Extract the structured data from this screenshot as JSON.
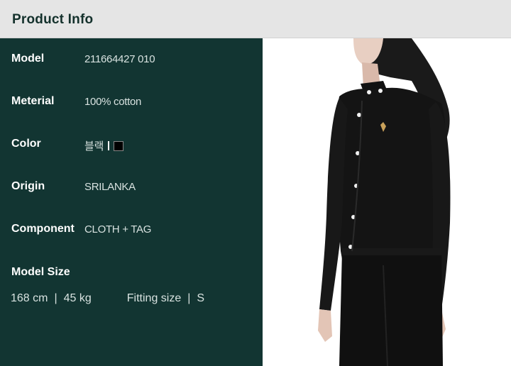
{
  "header": {
    "title": "Product Info"
  },
  "specs": [
    {
      "label": "Model",
      "value": "211664427 010"
    },
    {
      "label": "Meterial",
      "value": "100% cotton"
    },
    {
      "label": "Color",
      "value": "블랙"
    },
    {
      "label": "Origin",
      "value": "SRILANKA"
    },
    {
      "label": "Component",
      "value": "CLOTH + TAG"
    }
  ],
  "model_size": {
    "label": "Model Size",
    "height": "168 cm",
    "weight": "45 kg",
    "fitting_label": "Fitting size",
    "fitting_value": "S",
    "separator": "|"
  },
  "colors": {
    "header_bg": "#e5e5e5",
    "panel_bg": "#123532",
    "swatch": "#000000"
  }
}
